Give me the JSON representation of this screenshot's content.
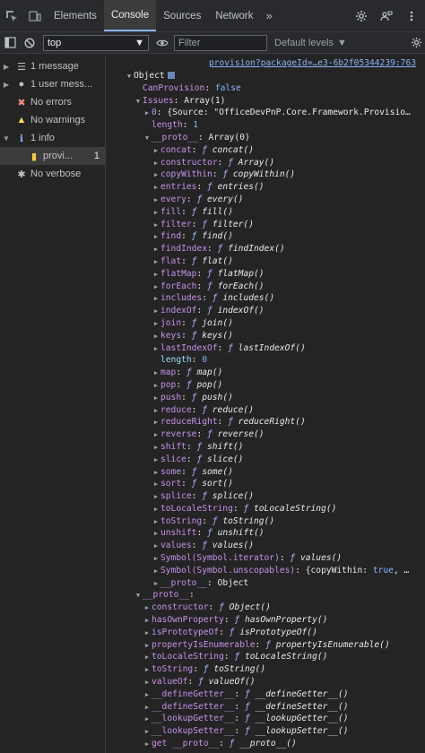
{
  "tabbar": {
    "tabs": [
      {
        "label": "Elements",
        "active": false
      },
      {
        "label": "Console",
        "active": true
      },
      {
        "label": "Sources",
        "active": false
      },
      {
        "label": "Network",
        "active": false
      }
    ],
    "more": "»"
  },
  "toolbar": {
    "context": "top",
    "filter_placeholder": "Filter",
    "levels": "Default levels"
  },
  "sidebar": {
    "items": [
      {
        "icon": "list-icon",
        "label": "1 message",
        "count": ""
      },
      {
        "icon": "user-icon",
        "label": "1 user mess...",
        "count": ""
      },
      {
        "icon": "error-icon",
        "label": "No errors",
        "count": ""
      },
      {
        "icon": "warning-icon",
        "label": "No warnings",
        "count": ""
      },
      {
        "icon": "info-icon",
        "label": "1 info",
        "count": ""
      },
      {
        "icon": "file-icon",
        "label": "provi...",
        "count": "1"
      },
      {
        "icon": "bug-icon",
        "label": "No verbose",
        "count": ""
      }
    ]
  },
  "console": {
    "source_link": "provision?packageId=…e3-6b2f05344239:763",
    "object_label": "Object",
    "can_provision_key": "CanProvision",
    "can_provision_val": "false",
    "issues_key": "Issues",
    "issues_val": "Array(1)",
    "issue0_key": "0",
    "issue0_val": "{Source: \"OfficeDevPnP.Core.Framework.Provisio…",
    "length_key": "length",
    "length_val": "1",
    "proto_key": "__proto__",
    "proto_val": "Array(0)",
    "array_methods": [
      {
        "k": "concat",
        "v": "concat()"
      },
      {
        "k": "constructor",
        "v": "Array()"
      },
      {
        "k": "copyWithin",
        "v": "copyWithin()"
      },
      {
        "k": "entries",
        "v": "entries()"
      },
      {
        "k": "every",
        "v": "every()"
      },
      {
        "k": "fill",
        "v": "fill()"
      },
      {
        "k": "filter",
        "v": "filter()"
      },
      {
        "k": "find",
        "v": "find()"
      },
      {
        "k": "findIndex",
        "v": "findIndex()"
      },
      {
        "k": "flat",
        "v": "flat()"
      },
      {
        "k": "flatMap",
        "v": "flatMap()"
      },
      {
        "k": "forEach",
        "v": "forEach()"
      },
      {
        "k": "includes",
        "v": "includes()"
      },
      {
        "k": "indexOf",
        "v": "indexOf()"
      },
      {
        "k": "join",
        "v": "join()"
      },
      {
        "k": "keys",
        "v": "keys()"
      },
      {
        "k": "lastIndexOf",
        "v": "lastIndexOf()"
      }
    ],
    "array_length_key": "length",
    "array_length_val": "0",
    "array_methods_2": [
      {
        "k": "map",
        "v": "map()"
      },
      {
        "k": "pop",
        "v": "pop()"
      },
      {
        "k": "push",
        "v": "push()"
      },
      {
        "k": "reduce",
        "v": "reduce()"
      },
      {
        "k": "reduceRight",
        "v": "reduceRight()"
      },
      {
        "k": "reverse",
        "v": "reverse()"
      },
      {
        "k": "shift",
        "v": "shift()"
      },
      {
        "k": "slice",
        "v": "slice()"
      },
      {
        "k": "some",
        "v": "some()"
      },
      {
        "k": "sort",
        "v": "sort()"
      },
      {
        "k": "splice",
        "v": "splice()"
      },
      {
        "k": "toLocaleString",
        "v": "toLocaleString()"
      },
      {
        "k": "toString",
        "v": "toString()"
      },
      {
        "k": "unshift",
        "v": "unshift()"
      },
      {
        "k": "values",
        "v": "values()"
      },
      {
        "k": "Symbol(Symbol.iterator)",
        "v": "values()"
      }
    ],
    "unscopables_key": "Symbol(Symbol.unscopables)",
    "unscopables_pre": "{copyWithin: ",
    "unscopables_bool": "true",
    "unscopables_post": ", …",
    "array_proto_key": "__proto__",
    "array_proto_val": "Object",
    "obj_proto_key": "__proto__",
    "object_methods": [
      {
        "k": "constructor",
        "v": "Object()"
      },
      {
        "k": "hasOwnProperty",
        "v": "hasOwnProperty()"
      },
      {
        "k": "isPrototypeOf",
        "v": "isPrototypeOf()"
      },
      {
        "k": "propertyIsEnumerable",
        "v": "propertyIsEnumerable()"
      },
      {
        "k": "toLocaleString",
        "v": "toLocaleString()"
      },
      {
        "k": "toString",
        "v": "toString()"
      },
      {
        "k": "valueOf",
        "v": "valueOf()"
      },
      {
        "k": "__defineGetter__",
        "v": "__defineGetter__()"
      },
      {
        "k": "__defineSetter__",
        "v": "__defineSetter__()"
      },
      {
        "k": "__lookupGetter__",
        "v": "__lookupGetter__()"
      },
      {
        "k": "__lookupSetter__",
        "v": "__lookupSetter__()"
      },
      {
        "k": "get __proto__",
        "v": "__proto__()"
      }
    ],
    "f_glyph": "ƒ"
  }
}
